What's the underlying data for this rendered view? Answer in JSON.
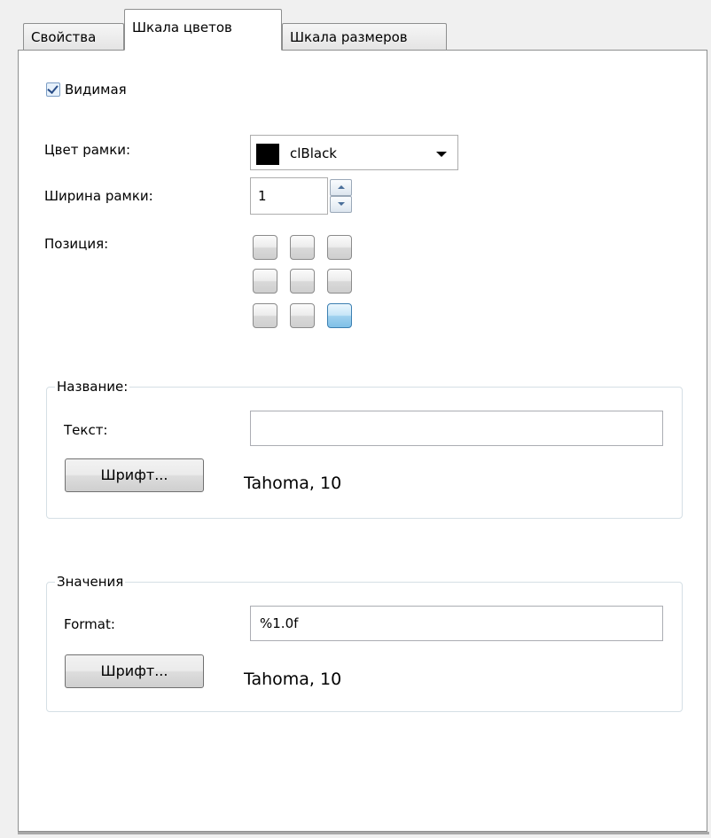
{
  "tabs": [
    {
      "label": "Свойства"
    },
    {
      "label": "Шкала цветов"
    },
    {
      "label": "Шкала размеров"
    }
  ],
  "visible": {
    "label": "Видимая",
    "checked": true
  },
  "border_color": {
    "label": "Цвет рамки:",
    "value": "clBlack",
    "swatch": "#000000"
  },
  "border_width": {
    "label": "Ширина рамки:",
    "value": "1"
  },
  "position": {
    "label": "Позиция:",
    "selected_index": 8
  },
  "name_group": {
    "title": "Название:",
    "text_label": "Текст:",
    "text_value": "",
    "font_button": "Шрифт...",
    "font_info": "Tahoma, 10"
  },
  "values_group": {
    "title": "Значения",
    "format_label": "Format:",
    "format_value": "%1.0f",
    "font_button": "Шрифт...",
    "font_info": "Tahoma, 10"
  }
}
